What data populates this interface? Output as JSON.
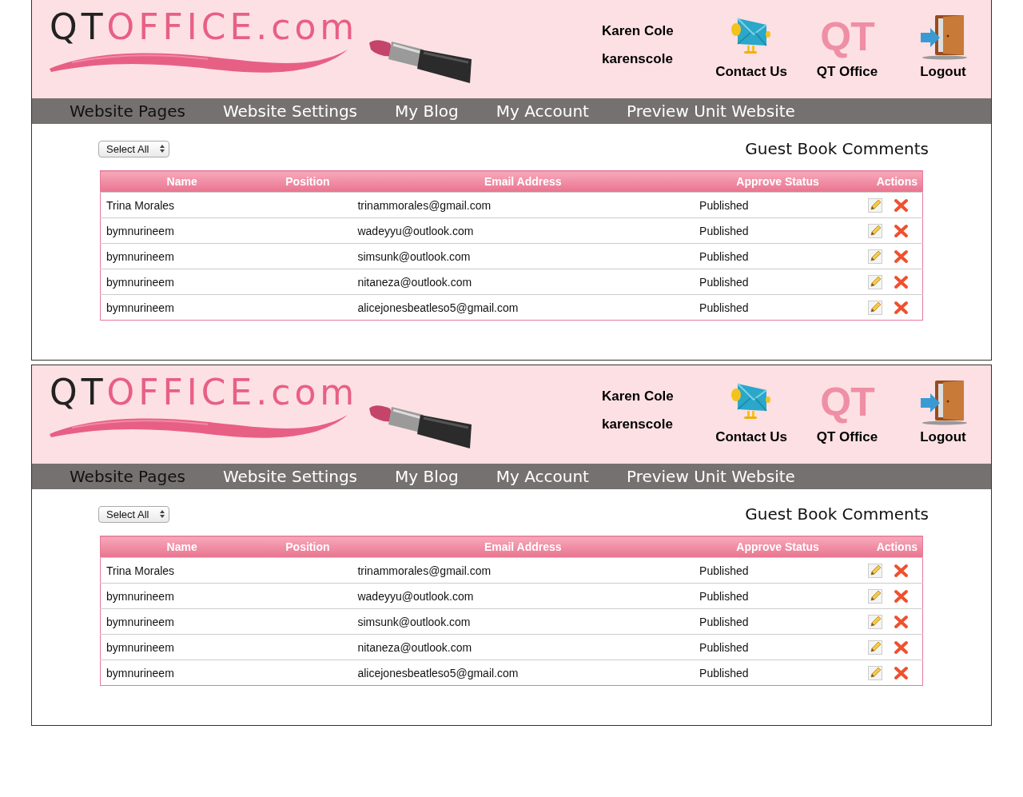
{
  "panels": [
    {
      "logo": {
        "dark": "QT",
        "accent": "OFFICE.com"
      },
      "user": {
        "name": "Karen Cole",
        "username": "karenscole"
      },
      "header_links": [
        {
          "kind": "contact",
          "label": "Contact Us"
        },
        {
          "kind": "office",
          "label": "QT Office",
          "icon_text": "QT"
        },
        {
          "kind": "logout",
          "label": "Logout"
        }
      ],
      "nav": [
        {
          "label": "Website Pages",
          "selected": true
        },
        {
          "label": "Website Settings",
          "selected": false
        },
        {
          "label": "My Blog",
          "selected": false
        },
        {
          "label": "My Account",
          "selected": false
        },
        {
          "label": "Preview Unit Website",
          "selected": false
        }
      ],
      "select_all": "Select All",
      "section_title": "Guest Book Comments",
      "table": {
        "columns": [
          "Name",
          "Position",
          "Email Address",
          "Approve Status",
          "Actions"
        ],
        "rows": [
          {
            "name": "Trina Morales",
            "email": "trinammorales@gmail.com",
            "status": "Published"
          },
          {
            "name": "bymnurineem",
            "email": "wadeyyu@outlook.com",
            "status": "Published"
          },
          {
            "name": "bymnurineem",
            "email": "simsunk@outlook.com",
            "status": "Published"
          },
          {
            "name": "bymnurineem",
            "email": "nitaneza@outlook.com",
            "status": "Published"
          },
          {
            "name": "bymnurineem",
            "email": "alicejonesbeatleso5@gmail.com",
            "status": "Published"
          }
        ]
      }
    },
    {
      "logo": {
        "dark": "QT",
        "accent": "OFFICE.com"
      },
      "user": {
        "name": "Karen Cole",
        "username": "karenscole"
      },
      "header_links": [
        {
          "kind": "contact",
          "label": "Contact Us"
        },
        {
          "kind": "office",
          "label": "QT Office",
          "icon_text": "QT"
        },
        {
          "kind": "logout",
          "label": "Logout"
        }
      ],
      "nav": [
        {
          "label": "Website Pages",
          "selected": true
        },
        {
          "label": "Website Settings",
          "selected": false
        },
        {
          "label": "My Blog",
          "selected": false
        },
        {
          "label": "My Account",
          "selected": false
        },
        {
          "label": "Preview Unit Website",
          "selected": false
        }
      ],
      "select_all": "Select All",
      "section_title": "Guest Book Comments",
      "table": {
        "columns": [
          "Name",
          "Position",
          "Email Address",
          "Approve Status",
          "Actions"
        ],
        "rows": [
          {
            "name": "Trina Morales",
            "email": "trinammorales@gmail.com",
            "status": "Published"
          },
          {
            "name": "bymnurineem",
            "email": "wadeyyu@outlook.com",
            "status": "Published"
          },
          {
            "name": "bymnurineem",
            "email": "simsunk@outlook.com",
            "status": "Published"
          },
          {
            "name": "bymnurineem",
            "email": "nitaneza@outlook.com",
            "status": "Published"
          },
          {
            "name": "bymnurineem",
            "email": "alicejonesbeatleso5@gmail.com",
            "status": "Published"
          }
        ]
      }
    }
  ]
}
